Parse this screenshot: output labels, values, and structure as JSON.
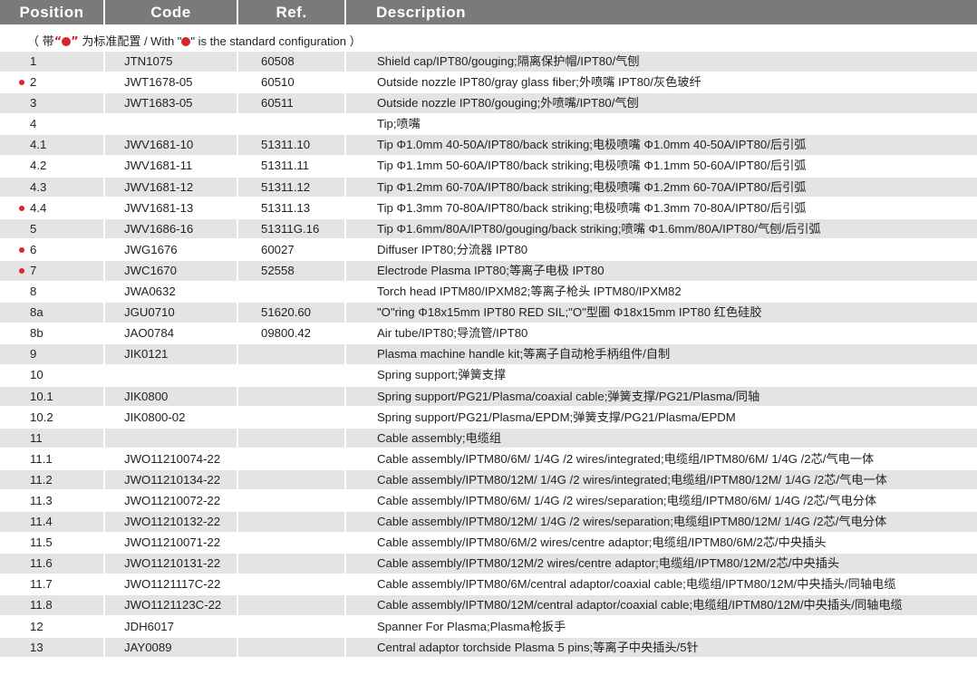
{
  "columns": {
    "position": "Position",
    "code": "Code",
    "ref": "Ref.",
    "description": "Description"
  },
  "note": {
    "prefix": "（ 带",
    "open_quote": "“",
    "close_quote": "”",
    "middle": "为标准配置 / With \"",
    "suffix": "\" is the standard configuration ）"
  },
  "colors": {
    "header_bg": "#7a7a7a",
    "header_text": "#ffffff",
    "row_shade": "#e4e4e4",
    "marker_red": "#d8262e"
  },
  "rows": [
    {
      "pos": "1",
      "code": "JTN1075",
      "ref": "60508",
      "desc": "Shield cap/IPT80/gouging;隔离保护帽/IPT80/气刨",
      "standard": false
    },
    {
      "pos": "2",
      "code": "JWT1678-05",
      "ref": "60510",
      "desc": "Outside nozzle IPT80/gray glass fiber;外喷嘴 IPT80/灰色玻纤",
      "standard": true
    },
    {
      "pos": "3",
      "code": "JWT1683-05",
      "ref": "60511",
      "desc": "Outside nozzle IPT80/gouging;外喷嘴/IPT80/气刨",
      "standard": false
    },
    {
      "pos": "4",
      "code": "",
      "ref": "",
      "desc": "Tip;喷嘴",
      "standard": false
    },
    {
      "pos": "4.1",
      "code": "JWV1681-10",
      "ref": "51311.10",
      "desc": "Tip  Φ1.0mm 40-50A/IPT80/back striking;电极喷嘴  Φ1.0mm 40-50A/IPT80/后引弧",
      "standard": false
    },
    {
      "pos": "4.2",
      "code": "JWV1681-11",
      "ref": "51311.11",
      "desc": "Tip  Φ1.1mm 50-60A/IPT80/back striking;电极喷嘴  Φ1.1mm 50-60A/IPT80/后引弧",
      "standard": false
    },
    {
      "pos": "4.3",
      "code": "JWV1681-12",
      "ref": "51311.12",
      "desc": "Tip  Φ1.2mm 60-70A/IPT80/back striking;电极喷嘴  Φ1.2mm 60-70A/IPT80/后引弧",
      "standard": false
    },
    {
      "pos": "4.4",
      "code": "JWV1681-13",
      "ref": "51311.13",
      "desc": "Tip  Φ1.3mm 70-80A/IPT80/back striking;电极喷嘴  Φ1.3mm 70-80A/IPT80/后引弧",
      "standard": true
    },
    {
      "pos": "5",
      "code": "JWV1686-16",
      "ref": "51311G.16",
      "desc": "Tip  Φ1.6mm/80A/IPT80/gouging/back striking;喷嘴  Φ1.6mm/80A/IPT80/气刨/后引弧",
      "standard": false
    },
    {
      "pos": "6",
      "code": "JWG1676",
      "ref": "60027",
      "desc": "Diffuser IPT80;分流器 IPT80",
      "standard": true
    },
    {
      "pos": "7",
      "code": "JWC1670",
      "ref": "52558",
      "desc": "Electrode Plasma IPT80;等离子电极 IPT80",
      "standard": true
    },
    {
      "pos": "8",
      "code": "JWA0632",
      "ref": "",
      "desc": "Torch head IPTM80/IPXM82;等离子枪头 IPTM80/IPXM82",
      "standard": false
    },
    {
      "pos": "8a",
      "code": "JGU0710",
      "ref": "51620.60",
      "desc": "\"O\"ring  Φ18x15mm IPT80 RED SIL;\"O\"型圈  Φ18x15mm IPT80 红色硅胶",
      "standard": false
    },
    {
      "pos": "8b",
      "code": "JAO0784",
      "ref": "09800.42",
      "desc": "Air tube/IPT80;导流管/IPT80",
      "standard": false
    },
    {
      "pos": "9",
      "code": "JIK0121",
      "ref": "",
      "desc": "Plasma machine handle kit;等离子自动枪手柄组件/自制",
      "standard": false
    },
    {
      "pos": "10",
      "code": "",
      "ref": "",
      "desc": "Spring support;弹簧支撑",
      "standard": false
    },
    {
      "pos": "10.1",
      "code": "JIK0800",
      "ref": "",
      "desc": "Spring support/PG21/Plasma/coaxial cable;弹簧支撑/PG21/Plasma/同轴",
      "standard": false
    },
    {
      "pos": "10.2",
      "code": "JIK0800-02",
      "ref": "",
      "desc": "Spring support/PG21/Plasma/EPDM;弹簧支撑/PG21/Plasma/EPDM",
      "standard": false
    },
    {
      "pos": "11",
      "code": "",
      "ref": "",
      "desc": "Cable assembly;电缆组",
      "standard": false
    },
    {
      "pos": "11.1",
      "code": "JWO11210074-22",
      "ref": "",
      "desc": "Cable assembly/IPTM80/6M/ 1/4G /2 wires/integrated;电缆组/IPTM80/6M/ 1/4G /2芯/气电一体",
      "standard": false
    },
    {
      "pos": "11.2",
      "code": "JWO11210134-22",
      "ref": "",
      "desc": "Cable assembly/IPTM80/12M/ 1/4G /2 wires/integrated;电缆组/IPTM80/12M/ 1/4G /2芯/气电一体",
      "standard": false
    },
    {
      "pos": "11.3",
      "code": "JWO11210072-22",
      "ref": "",
      "desc": "Cable assembly/IPTM80/6M/ 1/4G /2 wires/separation;电缆组/IPTM80/6M/ 1/4G /2芯/气电分体",
      "standard": false
    },
    {
      "pos": "11.4",
      "code": "JWO11210132-22",
      "ref": "",
      "desc": "Cable assembly/IPTM80/12M/ 1/4G /2 wires/separation;电缆组IPTM80/12M/ 1/4G /2芯/气电分体",
      "standard": false
    },
    {
      "pos": "11.5",
      "code": "JWO11210071-22",
      "ref": "",
      "desc": "Cable assembly/IPTM80/6M/2 wires/centre adaptor;电缆组/IPTM80/6M/2芯/中央插头",
      "standard": false
    },
    {
      "pos": "11.6",
      "code": "JWO11210131-22",
      "ref": "",
      "desc": "Cable assembly/IPTM80/12M/2 wires/centre adaptor;电缆组/IPTM80/12M/2芯/中央插头",
      "standard": false
    },
    {
      "pos": "11.7",
      "code": "JWO1121117C-22",
      "ref": "",
      "desc": "Cable assembly/IPTM80/6M/central  adaptor/coaxial cable;电缆组/IPTM80/12M/中央插头/同轴电缆",
      "standard": false
    },
    {
      "pos": "11.8",
      "code": "JWO1121123C-22",
      "ref": "",
      "desc": "Cable assembly/IPTM80/12M/central  adaptor/coaxial cable;电缆组/IPTM80/12M/中央插头/同轴电缆",
      "standard": false
    },
    {
      "pos": "12",
      "code": "JDH6017",
      "ref": "",
      "desc": "Spanner For Plasma;Plasma枪扳手",
      "standard": false
    },
    {
      "pos": "13",
      "code": "JAY0089",
      "ref": "",
      "desc": "Central  adaptor torchside Plasma 5 pins;等离子中央插头/5针",
      "standard": false
    }
  ]
}
